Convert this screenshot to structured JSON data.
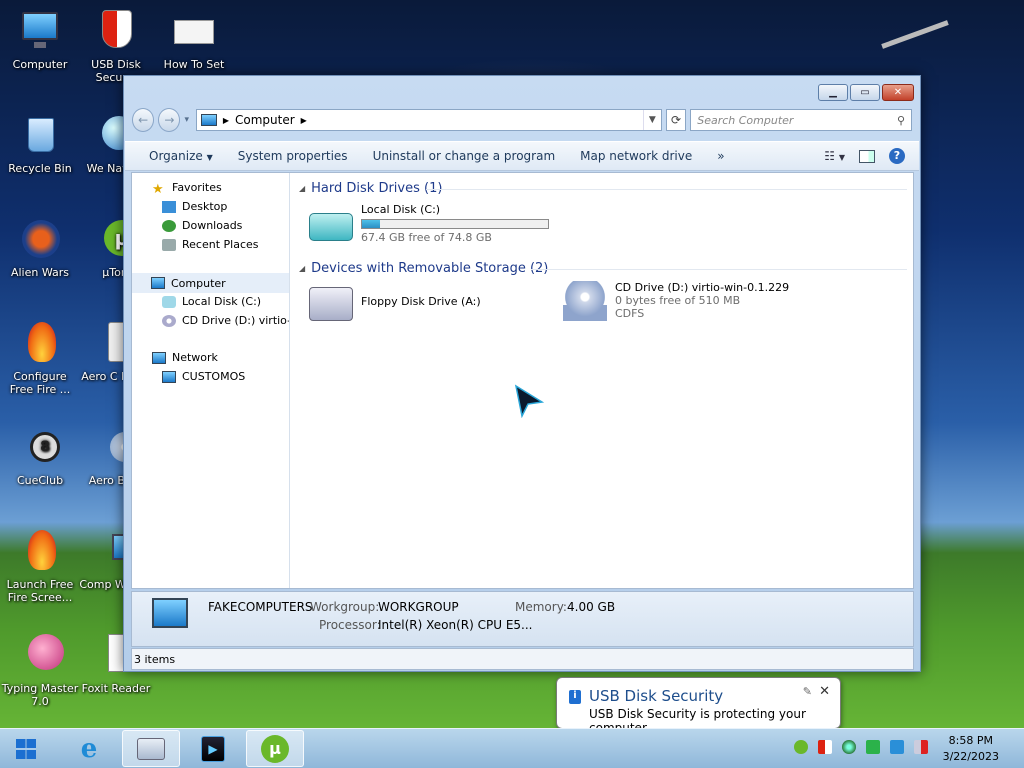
{
  "desktop": {
    "icons": [
      {
        "label": "Computer"
      },
      {
        "label": "USB Disk Secur..."
      },
      {
        "label": "How To Set"
      },
      {
        "label": "Recycle Bin"
      },
      {
        "label": "We Naviga"
      },
      {
        "label": "Alien Wars"
      },
      {
        "label": "µTorr"
      },
      {
        "label": "Configure Free Fire ..."
      },
      {
        "label": "Aero C Playe"
      },
      {
        "label": "CueClub"
      },
      {
        "label": "Aero Burn"
      },
      {
        "label": "Launch Free Fire Scree..."
      },
      {
        "label": "Comp Worms"
      },
      {
        "label": "Typing Master 7.0"
      },
      {
        "label": "Foxit Reader"
      }
    ]
  },
  "window": {
    "address": {
      "location": "Computer",
      "search_placeholder": "Search Computer"
    },
    "toolbar": {
      "organize": "Organize",
      "system_properties": "System properties",
      "uninstall": "Uninstall or change a program",
      "map_drive": "Map network drive",
      "more": "»"
    },
    "navpane": {
      "favorites": "Favorites",
      "desktop": "Desktop",
      "downloads": "Downloads",
      "recent": "Recent Places",
      "computer": "Computer",
      "local_disk": "Local Disk (C:)",
      "cd_drive": "CD Drive (D:) virtio-w",
      "network": "Network",
      "customos": "CUSTOMOS"
    },
    "groups": {
      "hdd_title": "Hard Disk Drives (1)",
      "removable_title": "Devices with Removable Storage (2)"
    },
    "drives": {
      "c_name": "Local Disk (C:)",
      "c_free": "67.4 GB free of 74.8 GB",
      "c_used_fraction": 0.099,
      "floppy_name": "Floppy Disk Drive (A:)",
      "cd_name": "CD Drive (D:) virtio-win-0.1.229",
      "cd_free": "0 bytes free of 510 MB",
      "cd_fs": "CDFS"
    },
    "details": {
      "computer_name": "FAKECOMPUTERS",
      "workgroup_label": "Workgroup:",
      "workgroup": "WORKGROUP",
      "memory_label": "Memory:",
      "memory": "4.00 GB",
      "processor_label": "Processor:",
      "processor": "Intel(R) Xeon(R) CPU E5..."
    },
    "status": {
      "items": "3 items"
    }
  },
  "notification": {
    "title": "USB Disk Security",
    "text": "USB Disk Security is protecting your computer"
  },
  "taskbar": {
    "time": "8:58 PM",
    "date": "3/22/2023"
  },
  "colors": {
    "accent": "#1e3a8a",
    "window_frame": "#c7dbf2",
    "capacity_fill": "#2b8fc4"
  }
}
